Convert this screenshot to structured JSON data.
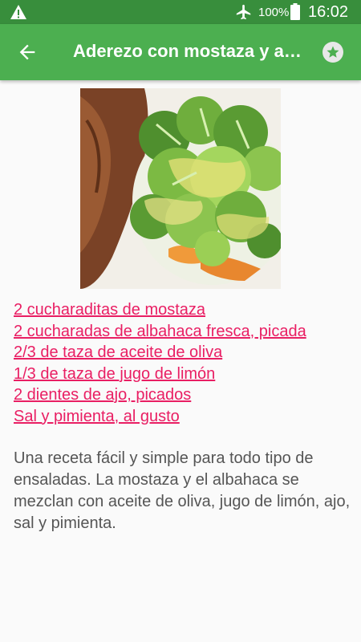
{
  "status_bar": {
    "battery_percent": "100%",
    "time": "16:02",
    "icons": [
      "warning-icon",
      "airplane-mode-icon",
      "battery-icon"
    ]
  },
  "app_bar": {
    "title": "Aderezo con mostaza y albahaca",
    "icons": [
      "back-arrow-icon",
      "favorite-star-icon"
    ]
  },
  "recipe": {
    "ingredients": [
      "2 cucharaditas de mostaza",
      "2 cucharadas de albahaca fresca, picada",
      "2/3 de taza de aceite de oliva",
      "1/3 de taza de jugo de limón",
      "2 dientes de ajo, picados",
      "Sal y pimienta, al gusto"
    ],
    "description": "Una receta fácil y simple para todo tipo de ensaladas. La mostaza y el albahaca se mezclan con aceite de oliva, jugo de limón, ajo, sal y pimienta."
  },
  "colors": {
    "status_bar": "#388e3c",
    "app_bar": "#4caf50",
    "link": "#e91e63",
    "body_text": "#555555"
  }
}
